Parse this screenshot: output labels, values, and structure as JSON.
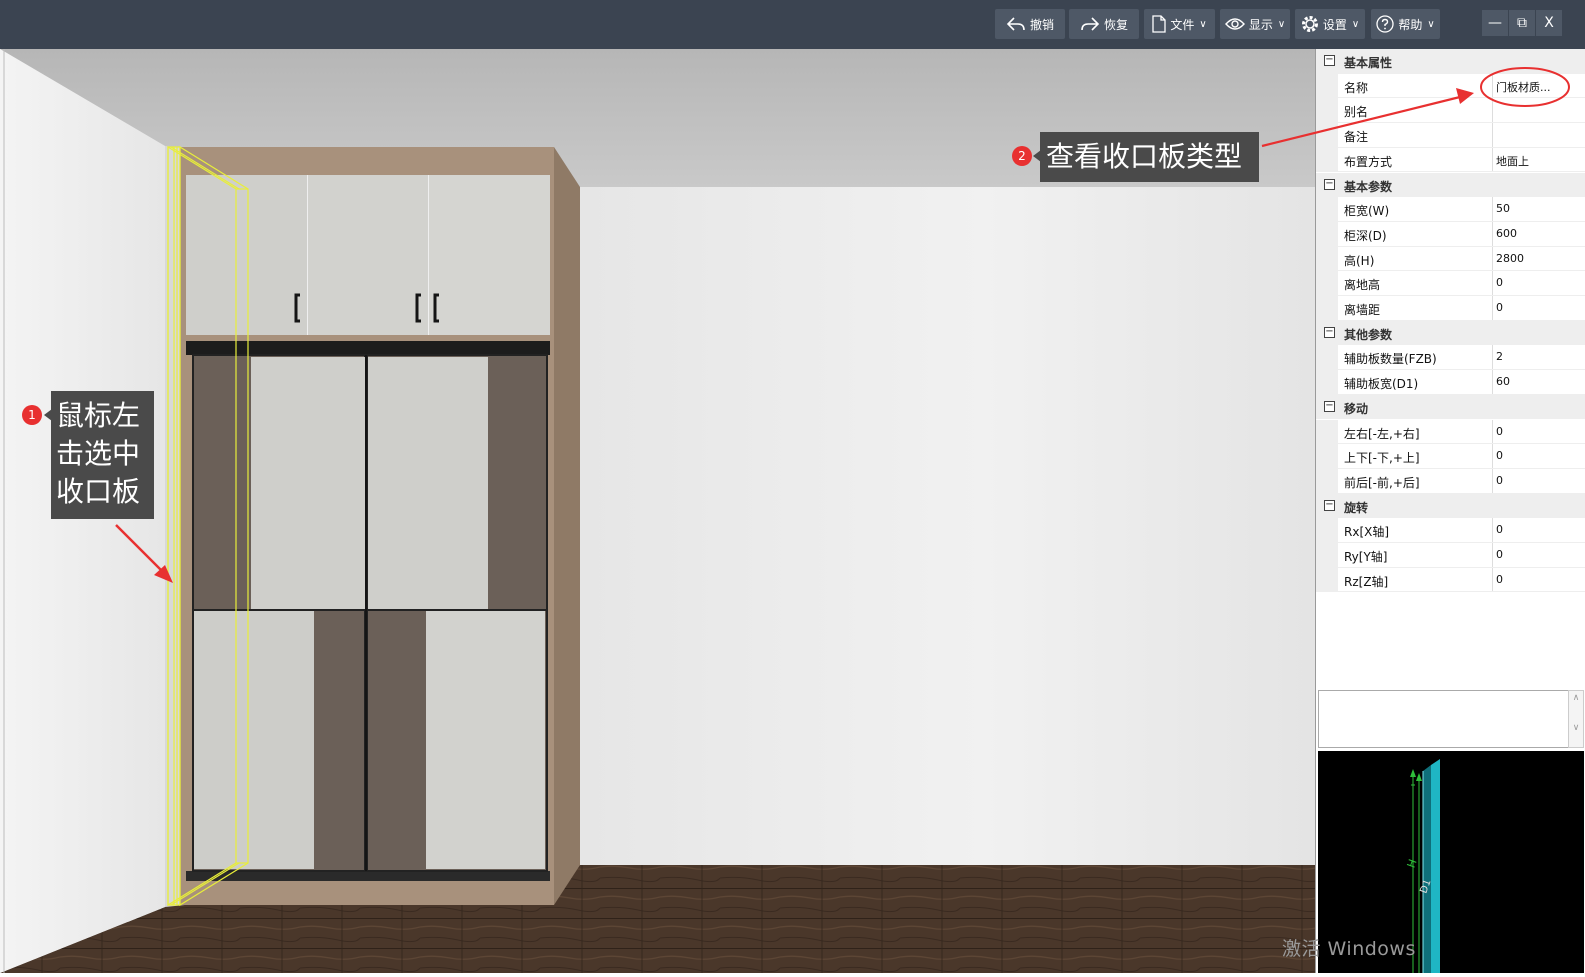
{
  "toolbar": {
    "undo": "撤销",
    "redo": "恢复",
    "file": "文件",
    "display": "显示",
    "settings": "设置",
    "help": "帮助",
    "chevron": "∨"
  },
  "window_controls": {
    "minimize": "—",
    "restore": "⧉",
    "close": "X"
  },
  "properties": {
    "groups": [
      {
        "label": "基本属性",
        "toggle": "−",
        "items": [
          {
            "name": "名称",
            "value": "门板材质..."
          },
          {
            "name": "别名",
            "value": ""
          },
          {
            "name": "备注",
            "value": ""
          },
          {
            "name": "布置方式",
            "value": "地面上"
          }
        ]
      },
      {
        "label": "基本参数",
        "toggle": "−",
        "items": [
          {
            "name": "柜宽(W)",
            "value": "50"
          },
          {
            "name": "柜深(D)",
            "value": "600"
          },
          {
            "name": "高(H)",
            "value": "2800"
          },
          {
            "name": "离地高",
            "value": "0"
          },
          {
            "name": "离墙距",
            "value": "0"
          }
        ]
      },
      {
        "label": "其他参数",
        "toggle": "−",
        "items": [
          {
            "name": "辅助板数量(FZB)",
            "value": "2"
          },
          {
            "name": "辅助板宽(D1)",
            "value": "60"
          }
        ]
      },
      {
        "label": "移动",
        "toggle": "−",
        "items": [
          {
            "name": "左右[-左,+右]",
            "value": "0"
          },
          {
            "name": "上下[-下,+上]",
            "value": "0"
          },
          {
            "name": "前后[-前,+后]",
            "value": "0"
          }
        ]
      },
      {
        "label": "旋转",
        "toggle": "−",
        "items": [
          {
            "name": "Rx[X轴]",
            "value": "0"
          },
          {
            "name": "Ry[Y轴]",
            "value": "0"
          },
          {
            "name": "Rz[Z轴]",
            "value": "0"
          }
        ]
      }
    ]
  },
  "scroll_arrows": {
    "up": "∧",
    "down": "∨"
  },
  "preview": {
    "label_h": "H",
    "label_d": "D1"
  },
  "annotations": {
    "step1_badge": "1",
    "step1_line1": "鼠标左",
    "step1_line2": "击选中",
    "step1_line3": "收口板",
    "step2_badge": "2",
    "step2_text": "查看收口板类型"
  },
  "watermark": "激活 Windows",
  "colors": {
    "titlebar": "#3b4451",
    "button": "#4e5866",
    "highlight": "#e8ee3a",
    "annotation": "#e83030"
  }
}
